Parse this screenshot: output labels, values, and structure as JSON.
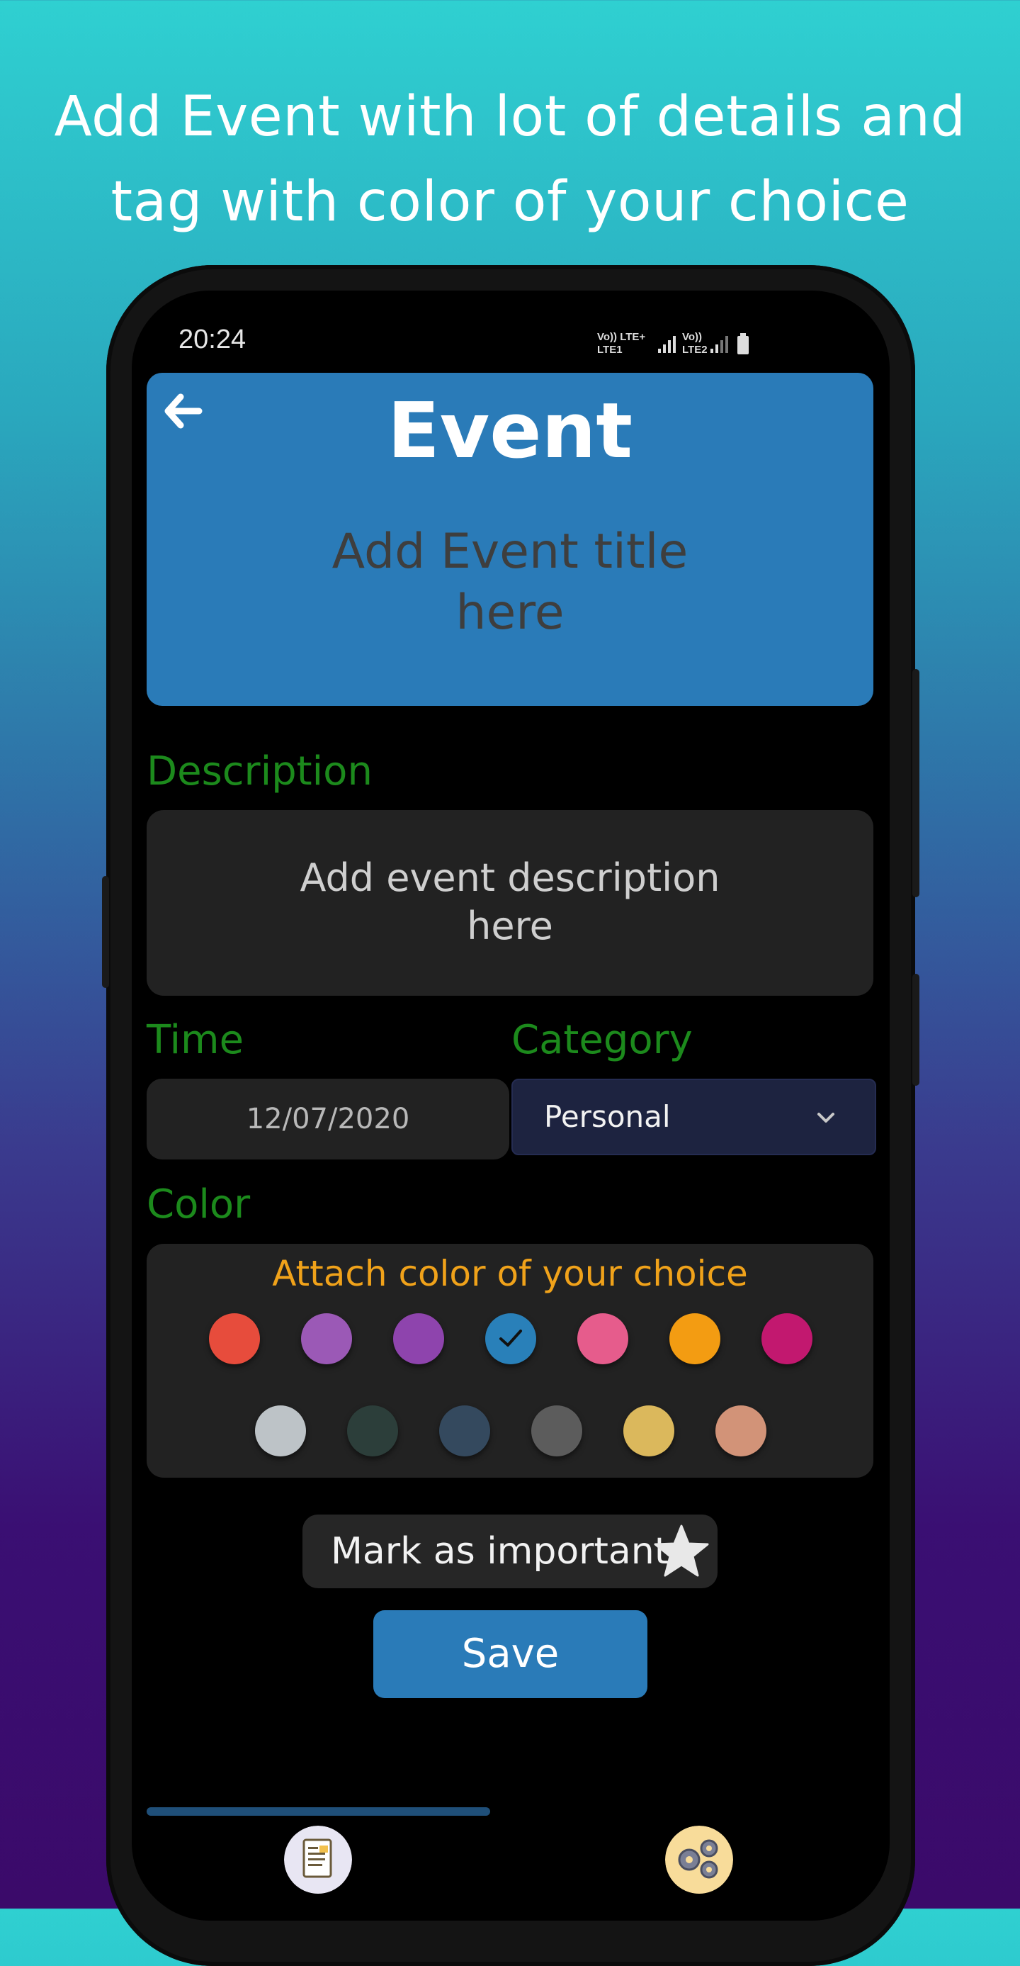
{
  "promo": {
    "headline_line1": "Add Event with lot of details and",
    "headline_line2": "tag with color of your choice"
  },
  "status_bar": {
    "time": "20:24",
    "network1": "Vo)) LTE+",
    "network1_sub": "LTE1",
    "network2": "Vo))",
    "network2_sub": "LTE2"
  },
  "header": {
    "title": "Event",
    "title_placeholder_line1": "Add Event title",
    "title_placeholder_line2": "here",
    "back_icon": "arrow-left-icon",
    "color": "#2a7bb8"
  },
  "description": {
    "label": "Description",
    "placeholder_line1": "Add event description",
    "placeholder_line2": "here"
  },
  "time": {
    "label": "Time",
    "value": "12/07/2020"
  },
  "category": {
    "label": "Category",
    "value": "Personal",
    "icon": "chevron-down-icon"
  },
  "color": {
    "label": "Color",
    "hint": "Attach color of your choice",
    "selected_index": 3,
    "swatches_row1": [
      "#e74c3c",
      "#9b59b6",
      "#8e44ad",
      "#2980b9",
      "#e65c8c",
      "#f39c12",
      "#c2186f"
    ],
    "swatches_row2": [
      "#bdc3c7",
      "#2c3e3a",
      "#34495e",
      "#5c5c5c",
      "#dbb85c",
      "#d29378"
    ]
  },
  "important": {
    "label": "Mark as important",
    "icon": "star-icon"
  },
  "save": {
    "label": "Save"
  },
  "bottom_nav": {
    "left_icon": "notes-document-icon",
    "right_icon": "settings-gears-icon"
  }
}
